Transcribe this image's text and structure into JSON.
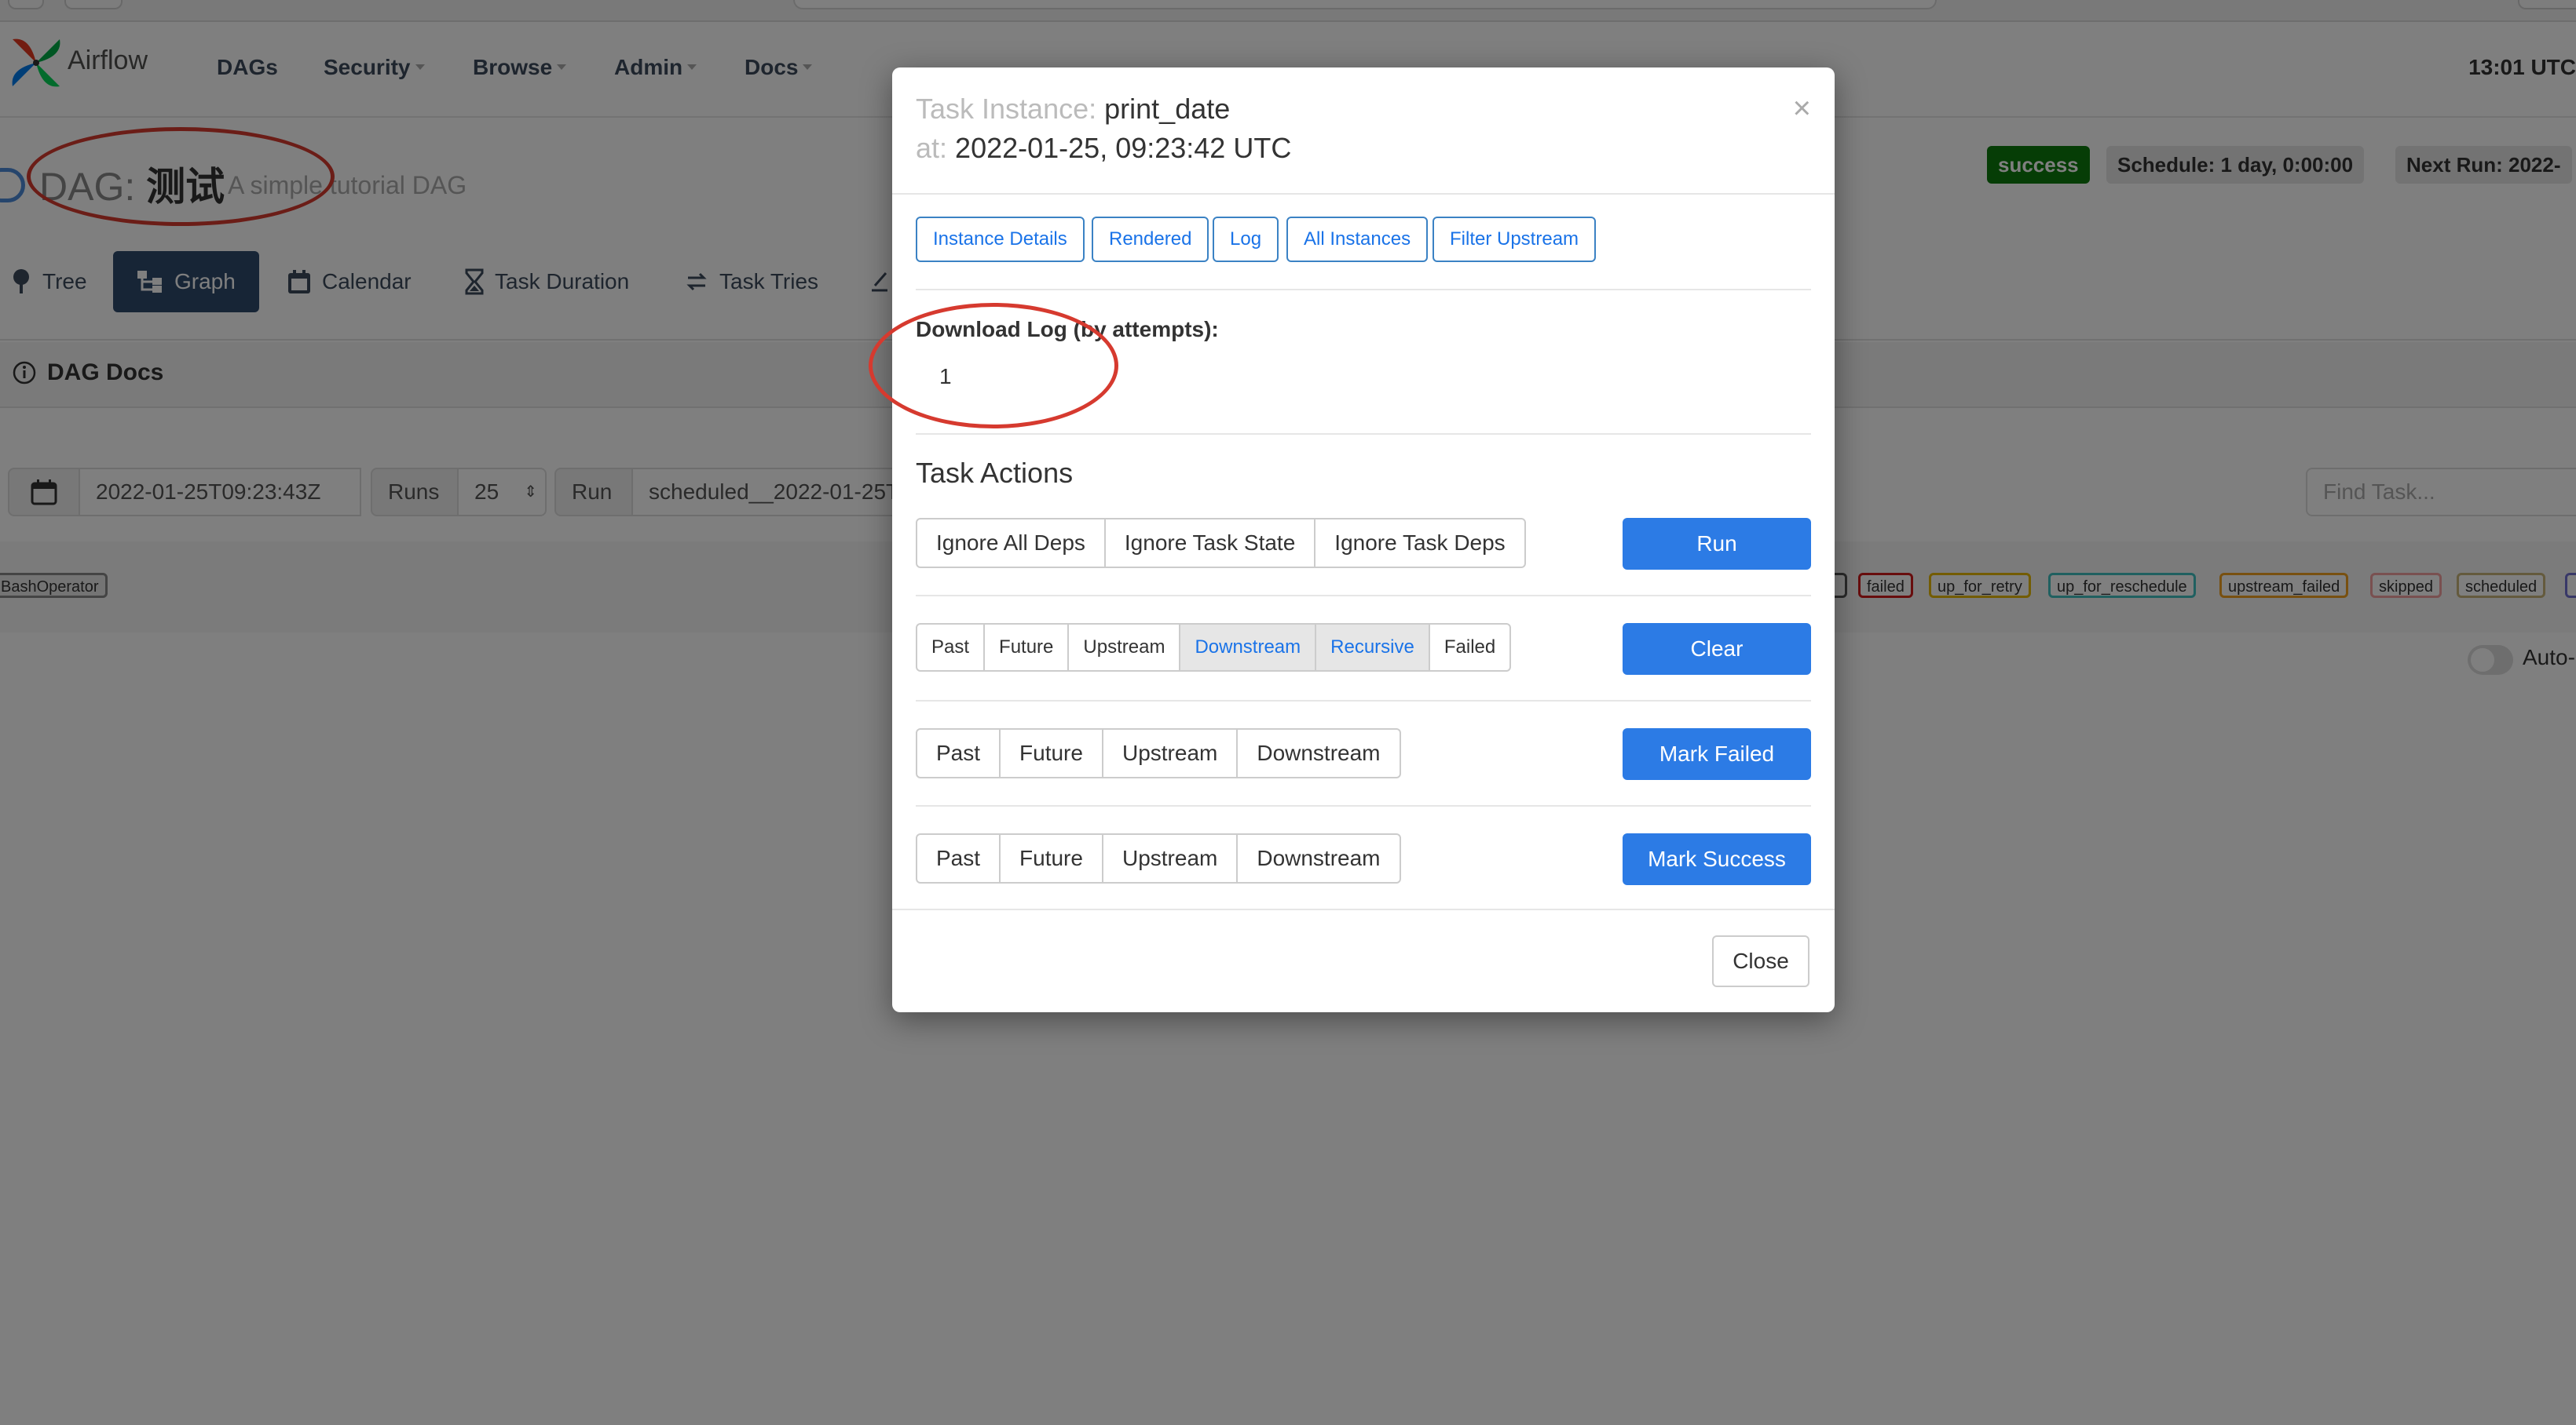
{
  "navbar": {
    "brand": "Airflow",
    "items": [
      {
        "label": "DAGs"
      },
      {
        "label": "Security"
      },
      {
        "label": "Browse"
      },
      {
        "label": "Admin"
      },
      {
        "label": "Docs"
      }
    ],
    "clock": "13:01 UTC"
  },
  "dag": {
    "prefix": "DAG:",
    "name": "测试",
    "description": "A simple tutorial DAG",
    "status": "success",
    "schedule": "Schedule: 1 day, 0:00:00",
    "next_run": "Next Run: 2022-"
  },
  "tabs": [
    {
      "label": "Tree"
    },
    {
      "label": "Graph"
    },
    {
      "label": "Calendar"
    },
    {
      "label": "Task Duration"
    },
    {
      "label": "Task Tries"
    }
  ],
  "dag_docs_label": "DAG Docs",
  "controls": {
    "date": "2022-01-25T09:23:43Z",
    "runs_label": "Runs",
    "runs_value": "25",
    "run_label": "Run",
    "run_value": "scheduled__2022-01-25T",
    "find_task_placeholder": "Find Task..."
  },
  "legend": {
    "operator": "BashOperator",
    "states": [
      {
        "label": "failed",
        "color": "#d11a1a"
      },
      {
        "label": "up_for_retry",
        "color": "#e6b800"
      },
      {
        "label": "up_for_reschedule",
        "color": "#40c0c0"
      },
      {
        "label": "upstream_failed",
        "color": "#f0a020"
      },
      {
        "label": "skipped",
        "color": "#f2a0a0"
      },
      {
        "label": "scheduled",
        "color": "#c9b57a"
      }
    ]
  },
  "auto_refresh_label": "Auto-",
  "modal": {
    "task_instance_label": "Task Instance:",
    "task_id": "print_date",
    "at_label": "at:",
    "execution_date": "2022-01-25, 09:23:42 UTC",
    "close_x": "×",
    "detail_buttons": [
      {
        "label": "Instance Details"
      },
      {
        "label": "Rendered"
      },
      {
        "label": "Log"
      },
      {
        "label": "All Instances"
      },
      {
        "label": "Filter Upstream"
      }
    ],
    "download_log_title": "Download Log (by attempts):",
    "attempt": "1",
    "task_actions_title": "Task Actions",
    "run_options": [
      "Ignore All Deps",
      "Ignore Task State",
      "Ignore Task Deps"
    ],
    "run_button": "Run",
    "clear_options": [
      {
        "label": "Past",
        "active": false
      },
      {
        "label": "Future",
        "active": false
      },
      {
        "label": "Upstream",
        "active": false
      },
      {
        "label": "Downstream",
        "active": true
      },
      {
        "label": "Recursive",
        "active": true
      },
      {
        "label": "Failed",
        "active": false
      }
    ],
    "clear_button": "Clear",
    "mark_failed_options": [
      "Past",
      "Future",
      "Upstream",
      "Downstream"
    ],
    "mark_failed_button": "Mark Failed",
    "mark_success_options": [
      "Past",
      "Future",
      "Upstream",
      "Downstream"
    ],
    "mark_success_button": "Mark Success",
    "close_button": "Close"
  },
  "colors": {
    "primary": "#2c7be5",
    "navbar_active": "#2f4b6d",
    "success": "#0d7a0d",
    "annotation": "#d63a2f"
  }
}
